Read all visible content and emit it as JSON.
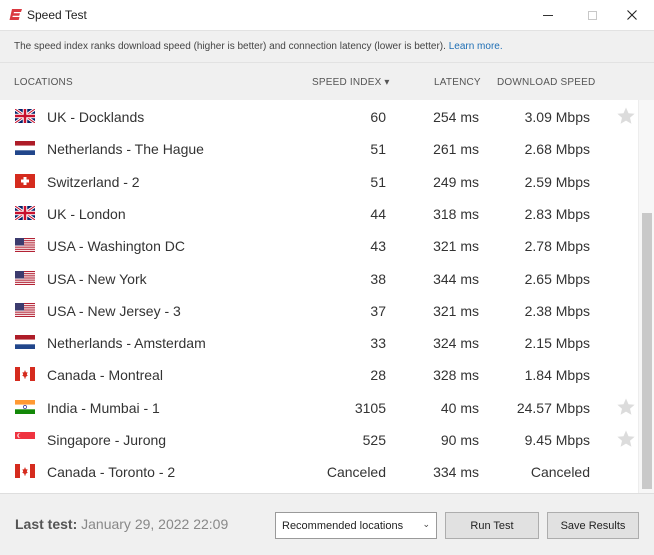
{
  "window": {
    "title": "Speed Test",
    "minimize_label": "minimize",
    "maximize_label": "maximize",
    "close_label": "close",
    "accent_color": "#da3940"
  },
  "info": {
    "text": "The speed index ranks download speed (higher is better) and connection latency (lower is better).",
    "link": "Learn more."
  },
  "columns": {
    "locations": "LOCATIONS",
    "speed_index": "SPEED INDEX ▾",
    "latency": "LATENCY",
    "download_speed": "DOWNLOAD SPEED"
  },
  "rows": [
    {
      "flag": "uk",
      "location": "UK - Docklands",
      "speed_index": "60",
      "latency": "254 ms",
      "download": "3.09 Mbps",
      "star": true
    },
    {
      "flag": "nl",
      "location": "Netherlands - The Hague",
      "speed_index": "51",
      "latency": "261 ms",
      "download": "2.68 Mbps",
      "star": false
    },
    {
      "flag": "ch",
      "location": "Switzerland - 2",
      "speed_index": "51",
      "latency": "249 ms",
      "download": "2.59 Mbps",
      "star": false
    },
    {
      "flag": "uk",
      "location": "UK - London",
      "speed_index": "44",
      "latency": "318 ms",
      "download": "2.83 Mbps",
      "star": false
    },
    {
      "flag": "us",
      "location": "USA - Washington DC",
      "speed_index": "43",
      "latency": "321 ms",
      "download": "2.78 Mbps",
      "star": false
    },
    {
      "flag": "us",
      "location": "USA - New York",
      "speed_index": "38",
      "latency": "344 ms",
      "download": "2.65 Mbps",
      "star": false
    },
    {
      "flag": "us",
      "location": "USA - New Jersey - 3",
      "speed_index": "37",
      "latency": "321 ms",
      "download": "2.38 Mbps",
      "star": false
    },
    {
      "flag": "nl",
      "location": "Netherlands - Amsterdam",
      "speed_index": "33",
      "latency": "324 ms",
      "download": "2.15 Mbps",
      "star": false
    },
    {
      "flag": "ca",
      "location": "Canada - Montreal",
      "speed_index": "28",
      "latency": "328 ms",
      "download": "1.84 Mbps",
      "star": false
    },
    {
      "flag": "in",
      "location": "India - Mumbai - 1",
      "speed_index": "3105",
      "latency": "40 ms",
      "download": "24.57 Mbps",
      "star": true
    },
    {
      "flag": "sg",
      "location": "Singapore - Jurong",
      "speed_index": "525",
      "latency": "90 ms",
      "download": "9.45 Mbps",
      "star": true
    },
    {
      "flag": "ca",
      "location": "Canada - Toronto - 2",
      "speed_index": "Canceled",
      "latency": "334 ms",
      "download": "Canceled",
      "star": false
    }
  ],
  "footer": {
    "last_test_label": "Last test:",
    "last_test_value": "January 29, 2022 22:09",
    "location_select": "Recommended locations",
    "run_test": "Run Test",
    "save_results": "Save Results"
  }
}
